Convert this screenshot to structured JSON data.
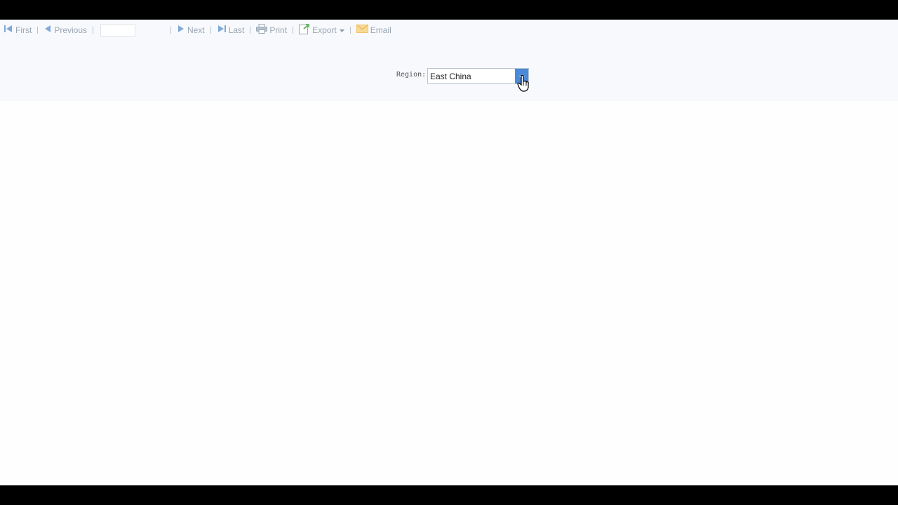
{
  "toolbar": {
    "first_label": "First",
    "previous_label": "Previous",
    "page_input_value": "",
    "page_total": "",
    "next_label": "Next",
    "last_label": "Last",
    "print_label": "Print",
    "export_label": "Export",
    "email_label": "Email",
    "icons": {
      "first": "skip-first-icon",
      "previous": "arrow-left-icon",
      "next": "arrow-right-icon",
      "last": "skip-last-icon",
      "print": "printer-icon",
      "export": "export-icon",
      "export_dropdown": "caret-down-icon",
      "email": "envelope-icon"
    }
  },
  "parameters": {
    "region_label": "Region:",
    "region_value": "East China",
    "dropdown_icon": "chevron-down-icon",
    "collapse_icon": "collapse-up-icon"
  },
  "colors": {
    "toolbar_text": "#9aa7b4",
    "toolbar_icon_blue": "#7fa9d8",
    "combo_button": "#4a8ad9",
    "email_icon": "#f2c56b",
    "export_icon": "#6db36d",
    "panel_background": "#f7f9fc"
  }
}
